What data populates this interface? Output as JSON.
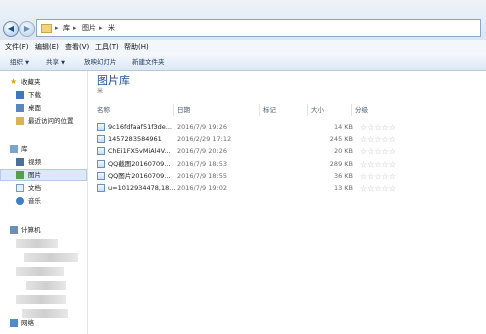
{
  "address": {
    "crumbs": [
      "库",
      "图片",
      "米"
    ]
  },
  "menu": [
    "文件(F)",
    "编辑(E)",
    "查看(V)",
    "工具(T)",
    "帮助(H)"
  ],
  "toolbar": {
    "organize": "组织",
    "share": "共享",
    "slideshow": "放映幻灯片",
    "new_folder": "新建文件夹",
    "dropdown": "▼"
  },
  "sidebar": {
    "favorites": "收藏夹",
    "downloads": "下载",
    "desktop": "桌面",
    "recent": "最近访问的位置",
    "libraries": "库",
    "videos": "视频",
    "pictures": "图片",
    "documents": "文档",
    "music": "音乐",
    "computer": "计算机",
    "network": "网络"
  },
  "library": {
    "title": "图片库",
    "subtitle": "米"
  },
  "columns": {
    "name": "名称",
    "date": "日期",
    "tags": "标记",
    "size": "大小",
    "rating": "分级"
  },
  "files": [
    {
      "name": "9c16fdfaaf51f3de...",
      "date": "2016/7/9 19:26",
      "size": "14 KB"
    },
    {
      "name": "1457283584961",
      "date": "2016/2/29 17:12",
      "size": "245 KB"
    },
    {
      "name": "ChEi1FX5vMiAl4V...",
      "date": "2016/7/9 20:26",
      "size": "20 KB"
    },
    {
      "name": "QQ截图20160709...",
      "date": "2016/7/9 18:53",
      "size": "289 KB"
    },
    {
      "name": "QQ图片20160709...",
      "date": "2016/7/9 18:55",
      "size": "36 KB"
    },
    {
      "name": "u=1012934478,18...",
      "date": "2016/7/9 19:02",
      "size": "13 KB"
    }
  ],
  "rating_stars": "☆☆☆☆☆",
  "icons": {
    "back": "◀",
    "forward": "▶",
    "sep": "▸"
  }
}
